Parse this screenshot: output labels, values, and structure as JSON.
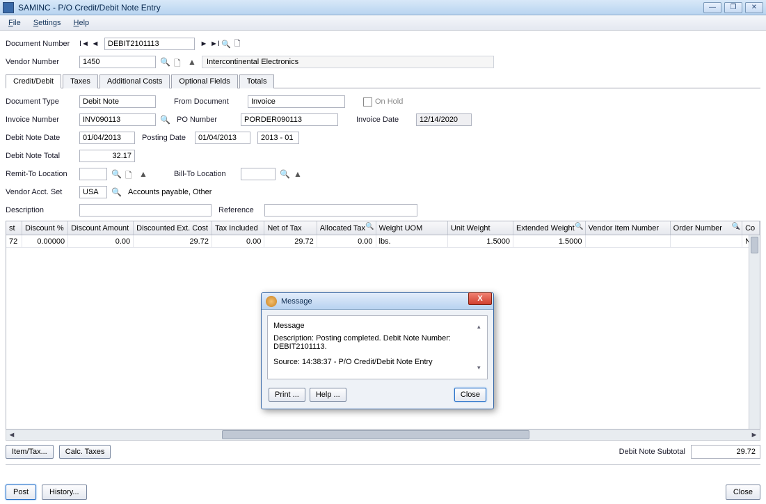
{
  "window": {
    "title": "SAMINC - P/O Credit/Debit Note Entry",
    "minimize": "—",
    "maximize": "❐",
    "close": "✕"
  },
  "menu": {
    "file": "File",
    "settings": "Settings",
    "help": "Help"
  },
  "header": {
    "doc_number_label": "Document Number",
    "doc_number": "DEBIT2101113",
    "vendor_number_label": "Vendor Number",
    "vendor_number": "1450",
    "vendor_name": "Intercontinental Electronics"
  },
  "tabs": {
    "credit_debit": "Credit/Debit",
    "taxes": "Taxes",
    "additional_costs": "Additional Costs",
    "optional_fields": "Optional Fields",
    "totals": "Totals"
  },
  "form": {
    "document_type_label": "Document Type",
    "document_type": "Debit Note",
    "from_document_label": "From Document",
    "from_document": "Invoice",
    "on_hold_label": "On Hold",
    "invoice_number_label": "Invoice Number",
    "invoice_number": "INV090113",
    "po_number_label": "PO Number",
    "po_number": "PORDER090113",
    "invoice_date_label": "Invoice Date",
    "invoice_date": "12/14/2020",
    "debit_note_date_label": "Debit Note Date",
    "debit_note_date": "01/04/2013",
    "posting_date_label": "Posting Date",
    "posting_date": "01/04/2013",
    "period": "2013 - 01",
    "debit_note_total_label": "Debit Note Total",
    "debit_note_total": "32.17",
    "remit_to_label": "Remit-To Location",
    "remit_to": "",
    "bill_to_label": "Bill-To Location",
    "bill_to": "",
    "vendor_acct_set_label": "Vendor Acct. Set",
    "vendor_acct_set": "USA",
    "acct_set_desc": "Accounts payable, Other",
    "description_label": "Description",
    "description": "",
    "reference_label": "Reference",
    "reference": ""
  },
  "grid": {
    "columns": [
      "st",
      "Discount %",
      "Discount Amount",
      "Discounted Ext. Cost",
      "Tax Included",
      "Net of Tax",
      "Allocated Tax",
      "Weight UOM",
      "Unit Weight",
      "Extended Weight",
      "Vendor Item Number",
      "Order Number",
      "Co"
    ],
    "search_cols": [
      6,
      9,
      11
    ],
    "sort_col": 11,
    "row": [
      "72",
      "0.00000",
      "0.00",
      "29.72",
      "0.00",
      "29.72",
      "0.00",
      "lbs.",
      "1.5000",
      "1.5000",
      "",
      "",
      "No"
    ]
  },
  "bottom": {
    "item_tax": "Item/Tax...",
    "calc_taxes": "Calc. Taxes",
    "subtotal_label": "Debit Note Subtotal",
    "subtotal_value": "29.72",
    "post": "Post",
    "history": "History...",
    "close": "Close"
  },
  "dialog": {
    "title": "Message",
    "msg_header": "Message",
    "description": "Description: Posting completed.  Debit Note Number: DEBIT2101113.",
    "source": "Source:  14:38:37 - P/O Credit/Debit Note Entry",
    "print": "Print ...",
    "help": "Help ...",
    "close": "Close"
  }
}
